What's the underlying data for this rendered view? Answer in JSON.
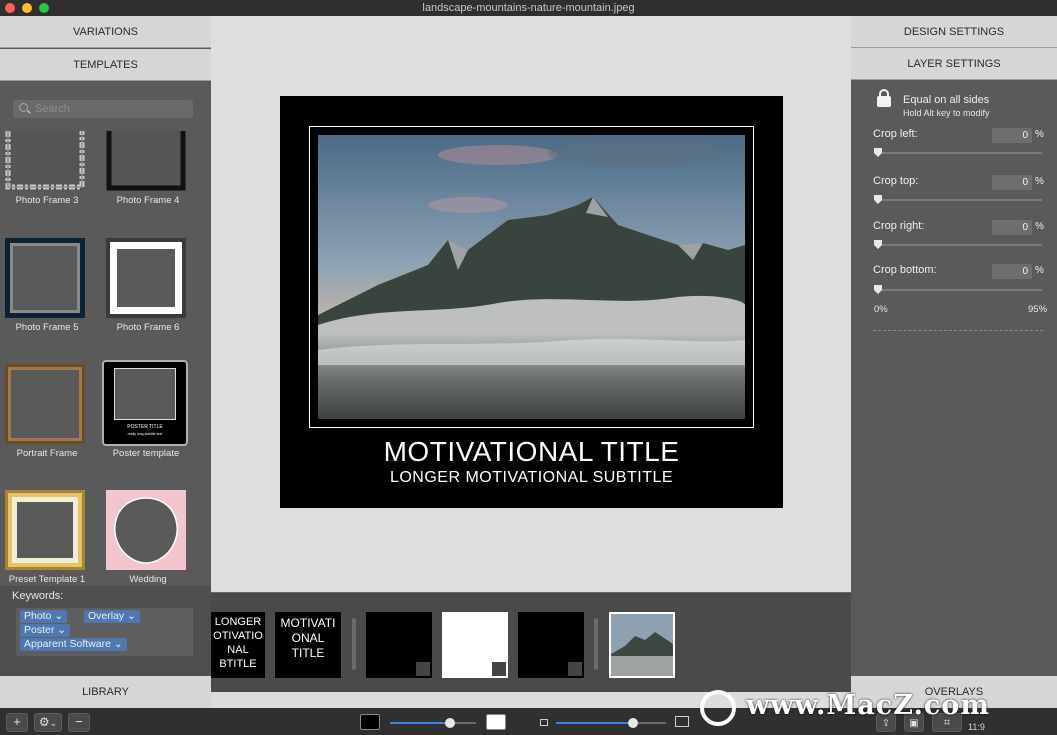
{
  "window": {
    "title": "landscape-mountains-nature-mountain.jpeg"
  },
  "left_panel": {
    "variations": "VARIATIONS",
    "templates": "TEMPLATES",
    "search_placeholder": "Search",
    "items": [
      {
        "label": "Photo Frame 3"
      },
      {
        "label": "Photo Frame 4"
      },
      {
        "label": "Photo Frame 5"
      },
      {
        "label": "Photo Frame 6"
      },
      {
        "label": "Portrait Frame"
      },
      {
        "label": "Poster template",
        "thumb_title": "POSTER TITLE",
        "thumb_subtitle": "really long subtitle text"
      },
      {
        "label": "Preset Template 1"
      },
      {
        "label": "Wedding"
      }
    ],
    "keywords_label": "Keywords:",
    "keywords": [
      "Photo",
      "Overlay",
      "Poster",
      "Apparent Software"
    ],
    "library": "LIBRARY"
  },
  "canvas": {
    "title": "MOTIVATIONAL TITLE",
    "subtitle": "LONGER MOTIVATIONAL SUBTITLE"
  },
  "filmstrip": {
    "item1_text": [
      "LONGER",
      "OTIVATIO",
      "NAL",
      "BTITLE"
    ],
    "item2_text": [
      "MOTIVATI",
      "ONAL",
      "TITLE"
    ]
  },
  "right_panel": {
    "design_settings": "DESIGN SETTINGS",
    "layer_settings": "LAYER SETTINGS",
    "equal_label": "Equal on all sides",
    "equal_hint": "Hold Alt key to modify",
    "crops": [
      {
        "label": "Crop left:",
        "value": "0",
        "unit": "%"
      },
      {
        "label": "Crop top:",
        "value": "0",
        "unit": "%"
      },
      {
        "label": "Crop right:",
        "value": "0",
        "unit": "%"
      },
      {
        "label": "Crop bottom:",
        "value": "0",
        "unit": "%"
      }
    ],
    "range_min": "0%",
    "range_max": "95%",
    "overlays": "OVERLAYS"
  },
  "bottombar": {
    "add": "+",
    "remove": "−",
    "gear": "⚙",
    "zoom_value": 0.7,
    "size_value": 0.7,
    "ratio": "11:9"
  },
  "watermark": {
    "text": "www.MacZ.com"
  },
  "colors": {
    "accent": "#3f82e6",
    "chip": "#4f77b0",
    "panel": "#5a5a5a",
    "header": "#d6d6d6"
  }
}
